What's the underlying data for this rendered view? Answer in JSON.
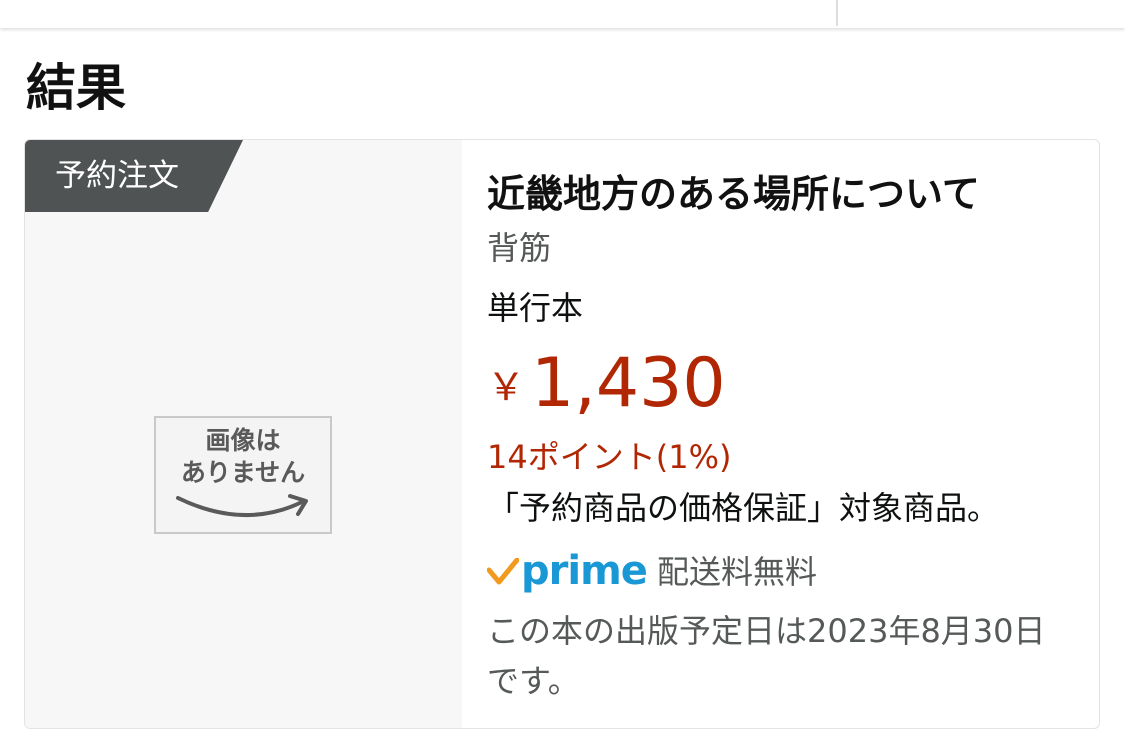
{
  "section": {
    "title": "結果"
  },
  "product": {
    "badge": "予約注文",
    "no_image": {
      "line1": "画像は",
      "line2": "ありません"
    },
    "title": "近畿地方のある場所について",
    "author": "背筋",
    "format": "単行本",
    "price": {
      "currency": "￥",
      "amount": "1,430"
    },
    "points": "14ポイント(1%)",
    "guarantee": "「予約商品の価格保証」対象商品。",
    "prime": {
      "logo_text": "prime",
      "shipping": "配送料無料"
    },
    "release_note": "この本の出版予定日は2023年8月30日です。"
  },
  "colors": {
    "price": "#b12704",
    "badge_bg": "#505353",
    "prime_blue": "#1a98d5",
    "prime_check": "#f29a1e"
  },
  "icons": {
    "prime_check": "check-icon",
    "smile": "amazon-smile-icon"
  }
}
